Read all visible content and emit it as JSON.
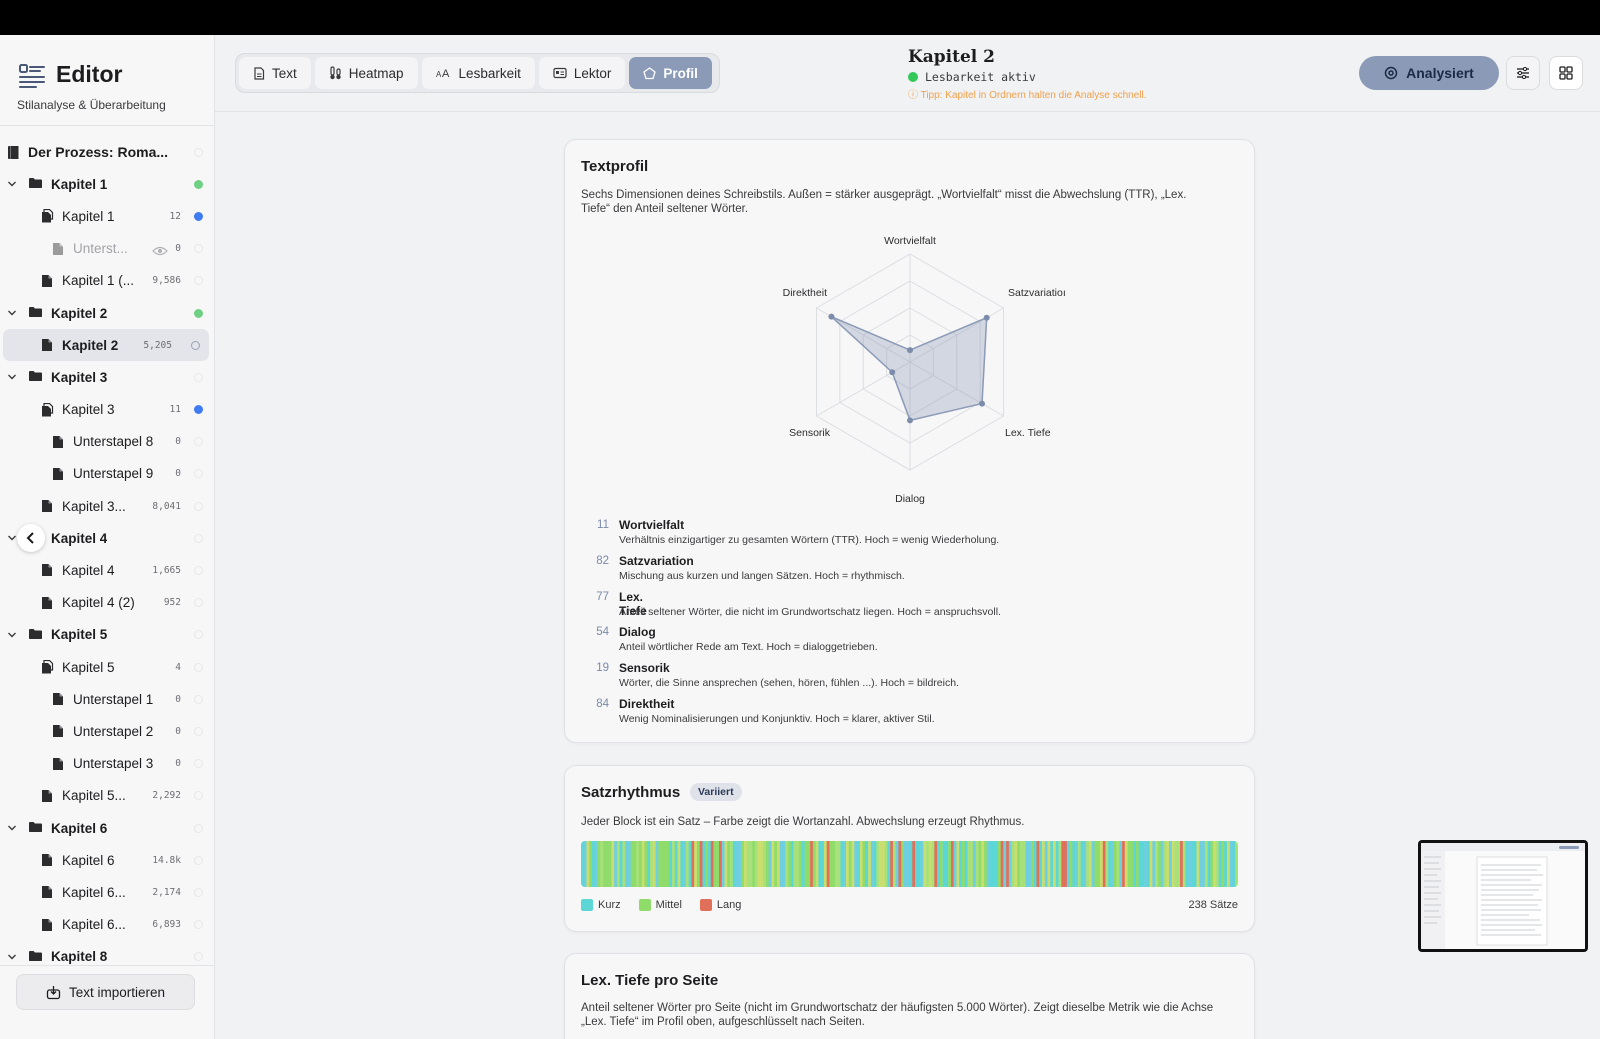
{
  "brand": {
    "title": "Editor",
    "subtitle": "Stilanalyse & Überarbeitung"
  },
  "tree": [
    {
      "label": "Der Prozess: Roma...",
      "type": "book",
      "level": 0,
      "count": "",
      "dot": "empty"
    },
    {
      "label": "Kapitel 1",
      "type": "folder",
      "level": 1,
      "count": "",
      "dot": "green"
    },
    {
      "label": "Kapitel 1",
      "type": "docs",
      "level": 2,
      "count": "12",
      "dot": "blue"
    },
    {
      "label": "Unterst...",
      "type": "doc",
      "level": 3,
      "count": "0",
      "dot": "empty",
      "dim": true,
      "eye": true
    },
    {
      "label": "Kapitel 1 (...",
      "type": "doc",
      "level": 2,
      "count": "9,586",
      "dot": "empty"
    },
    {
      "label": "Kapitel 2",
      "type": "folder",
      "level": 1,
      "count": "",
      "dot": "green"
    },
    {
      "label": "Kapitel 2",
      "type": "doc",
      "level": 2,
      "count": "5,205",
      "dot": "ring",
      "selected": true
    },
    {
      "label": "Kapitel 3",
      "type": "folder",
      "level": 1,
      "count": "",
      "dot": "empty"
    },
    {
      "label": "Kapitel 3",
      "type": "docs",
      "level": 2,
      "count": "11",
      "dot": "blue"
    },
    {
      "label": "Unterstapel 8",
      "type": "doc",
      "level": 3,
      "count": "0",
      "dot": "empty"
    },
    {
      "label": "Unterstapel 9",
      "type": "doc",
      "level": 3,
      "count": "0",
      "dot": "empty"
    },
    {
      "label": "Kapitel 3...",
      "type": "doc",
      "level": 2,
      "count": "8,041",
      "dot": "empty"
    },
    {
      "label": "Kapitel 4",
      "type": "folder",
      "level": 1,
      "count": "",
      "dot": "empty"
    },
    {
      "label": "Kapitel 4",
      "type": "doc",
      "level": 2,
      "count": "1,665",
      "dot": "empty"
    },
    {
      "label": "Kapitel 4 (2)",
      "type": "doc",
      "level": 2,
      "count": "952",
      "dot": "empty"
    },
    {
      "label": "Kapitel 5",
      "type": "folder",
      "level": 1,
      "count": "",
      "dot": "empty"
    },
    {
      "label": "Kapitel 5",
      "type": "docs",
      "level": 2,
      "count": "4",
      "dot": "empty"
    },
    {
      "label": "Unterstapel 1",
      "type": "doc",
      "level": 3,
      "count": "0",
      "dot": "empty"
    },
    {
      "label": "Unterstapel 2",
      "type": "doc",
      "level": 3,
      "count": "0",
      "dot": "empty"
    },
    {
      "label": "Unterstapel 3",
      "type": "doc",
      "level": 3,
      "count": "0",
      "dot": "empty"
    },
    {
      "label": "Kapitel 5...",
      "type": "doc",
      "level": 2,
      "count": "2,292",
      "dot": "empty"
    },
    {
      "label": "Kapitel 6",
      "type": "folder",
      "level": 1,
      "count": "",
      "dot": "empty"
    },
    {
      "label": "Kapitel 6",
      "type": "doc",
      "level": 2,
      "count": "14.8k",
      "dot": "empty"
    },
    {
      "label": "Kapitel 6...",
      "type": "doc",
      "level": 2,
      "count": "2,174",
      "dot": "empty"
    },
    {
      "label": "Kapitel 6...",
      "type": "doc",
      "level": 2,
      "count": "6,893",
      "dot": "empty"
    },
    {
      "label": "Kapitel 8",
      "type": "folder",
      "level": 1,
      "count": "",
      "dot": "empty"
    }
  ],
  "import_label": "Text importieren",
  "tabs": [
    {
      "label": "Text",
      "icon": "document-icon"
    },
    {
      "label": "Heatmap",
      "icon": "thermometer-icon"
    },
    {
      "label": "Lesbarkeit",
      "icon": "text-size-icon"
    },
    {
      "label": "Lektor",
      "icon": "card-icon"
    },
    {
      "label": "Profil",
      "icon": "pentagon-icon",
      "active": true
    }
  ],
  "doc": {
    "title": "Kapitel 2",
    "status": "Lesbarkeit aktiv",
    "tip": "ⓘ Tipp: Kapitel in Ordnern halten die Analyse schnell."
  },
  "analyze_label": "Analysiert",
  "profile": {
    "title": "Textprofil",
    "desc": "Sechs Dimensionen deines Schreibstils. Außen = stärker ausgeprägt. „Wortvielfalt“ misst die Abwechslung (TTR), „Lex. Tiefe“ den Anteil seltener Wörter.",
    "dimensions": [
      {
        "value": 11,
        "name": "Wortvielfalt",
        "axis": "Wortvielfalt",
        "expl": "Verhältnis einzigartiger zu gesamten Wörtern (TTR). Hoch = wenig Wiederholung."
      },
      {
        "value": 82,
        "name": "Satzvariation",
        "axis": "Satzvariatioı",
        "expl": "Mischung aus kurzen und langen Sätzen. Hoch = rhythmisch."
      },
      {
        "value": 77,
        "name": "Lex. Tiefe",
        "axis": "Lex. Tiefe",
        "expl": "Anteil seltener Wörter, die nicht im Grundwortschatz liegen. Hoch = anspruchsvoll."
      },
      {
        "value": 54,
        "name": "Dialog",
        "axis": "Dialog",
        "expl": "Anteil wörtlicher Rede am Text. Hoch = dialoggetrieben."
      },
      {
        "value": 19,
        "name": "Sensorik",
        "axis": "Sensorik",
        "expl": "Wörter, die Sinne ansprechen (sehen, hören, fühlen ...). Hoch = bildreich."
      },
      {
        "value": 84,
        "name": "Direktheit",
        "axis": "Direktheit",
        "expl": "Wenig Nominalisierungen und Konjunktiv. Hoch = klarer, aktiver Stil."
      }
    ],
    "radar_color": "#8b9ab6"
  },
  "rhythm": {
    "title": "Satzrhythmus",
    "badge": "Variiert",
    "desc": "Jeder Block ist ein Satz – Farbe zeigt die Wortanzahl. Abwechslung erzeugt Rhythmus.",
    "legend": [
      {
        "label": "Kurz",
        "color": "#5dd6d6"
      },
      {
        "label": "Mittel",
        "color": "#8fdc6a"
      },
      {
        "label": "Lang",
        "color": "#e0705a"
      }
    ],
    "sentences_label": "238 Sätze",
    "sentence_count": 238
  },
  "lexdepth": {
    "title": "Lex. Tiefe pro Seite",
    "desc": "Anteil seltener Wörter pro Seite (nicht im Grundwortschatz der häufigsten 5.000 Wörter). Zeigt dieselbe Metrik wie die Achse „Lex. Tiefe“ im Profil oben, aufgeschlüsselt nach Seiten."
  }
}
